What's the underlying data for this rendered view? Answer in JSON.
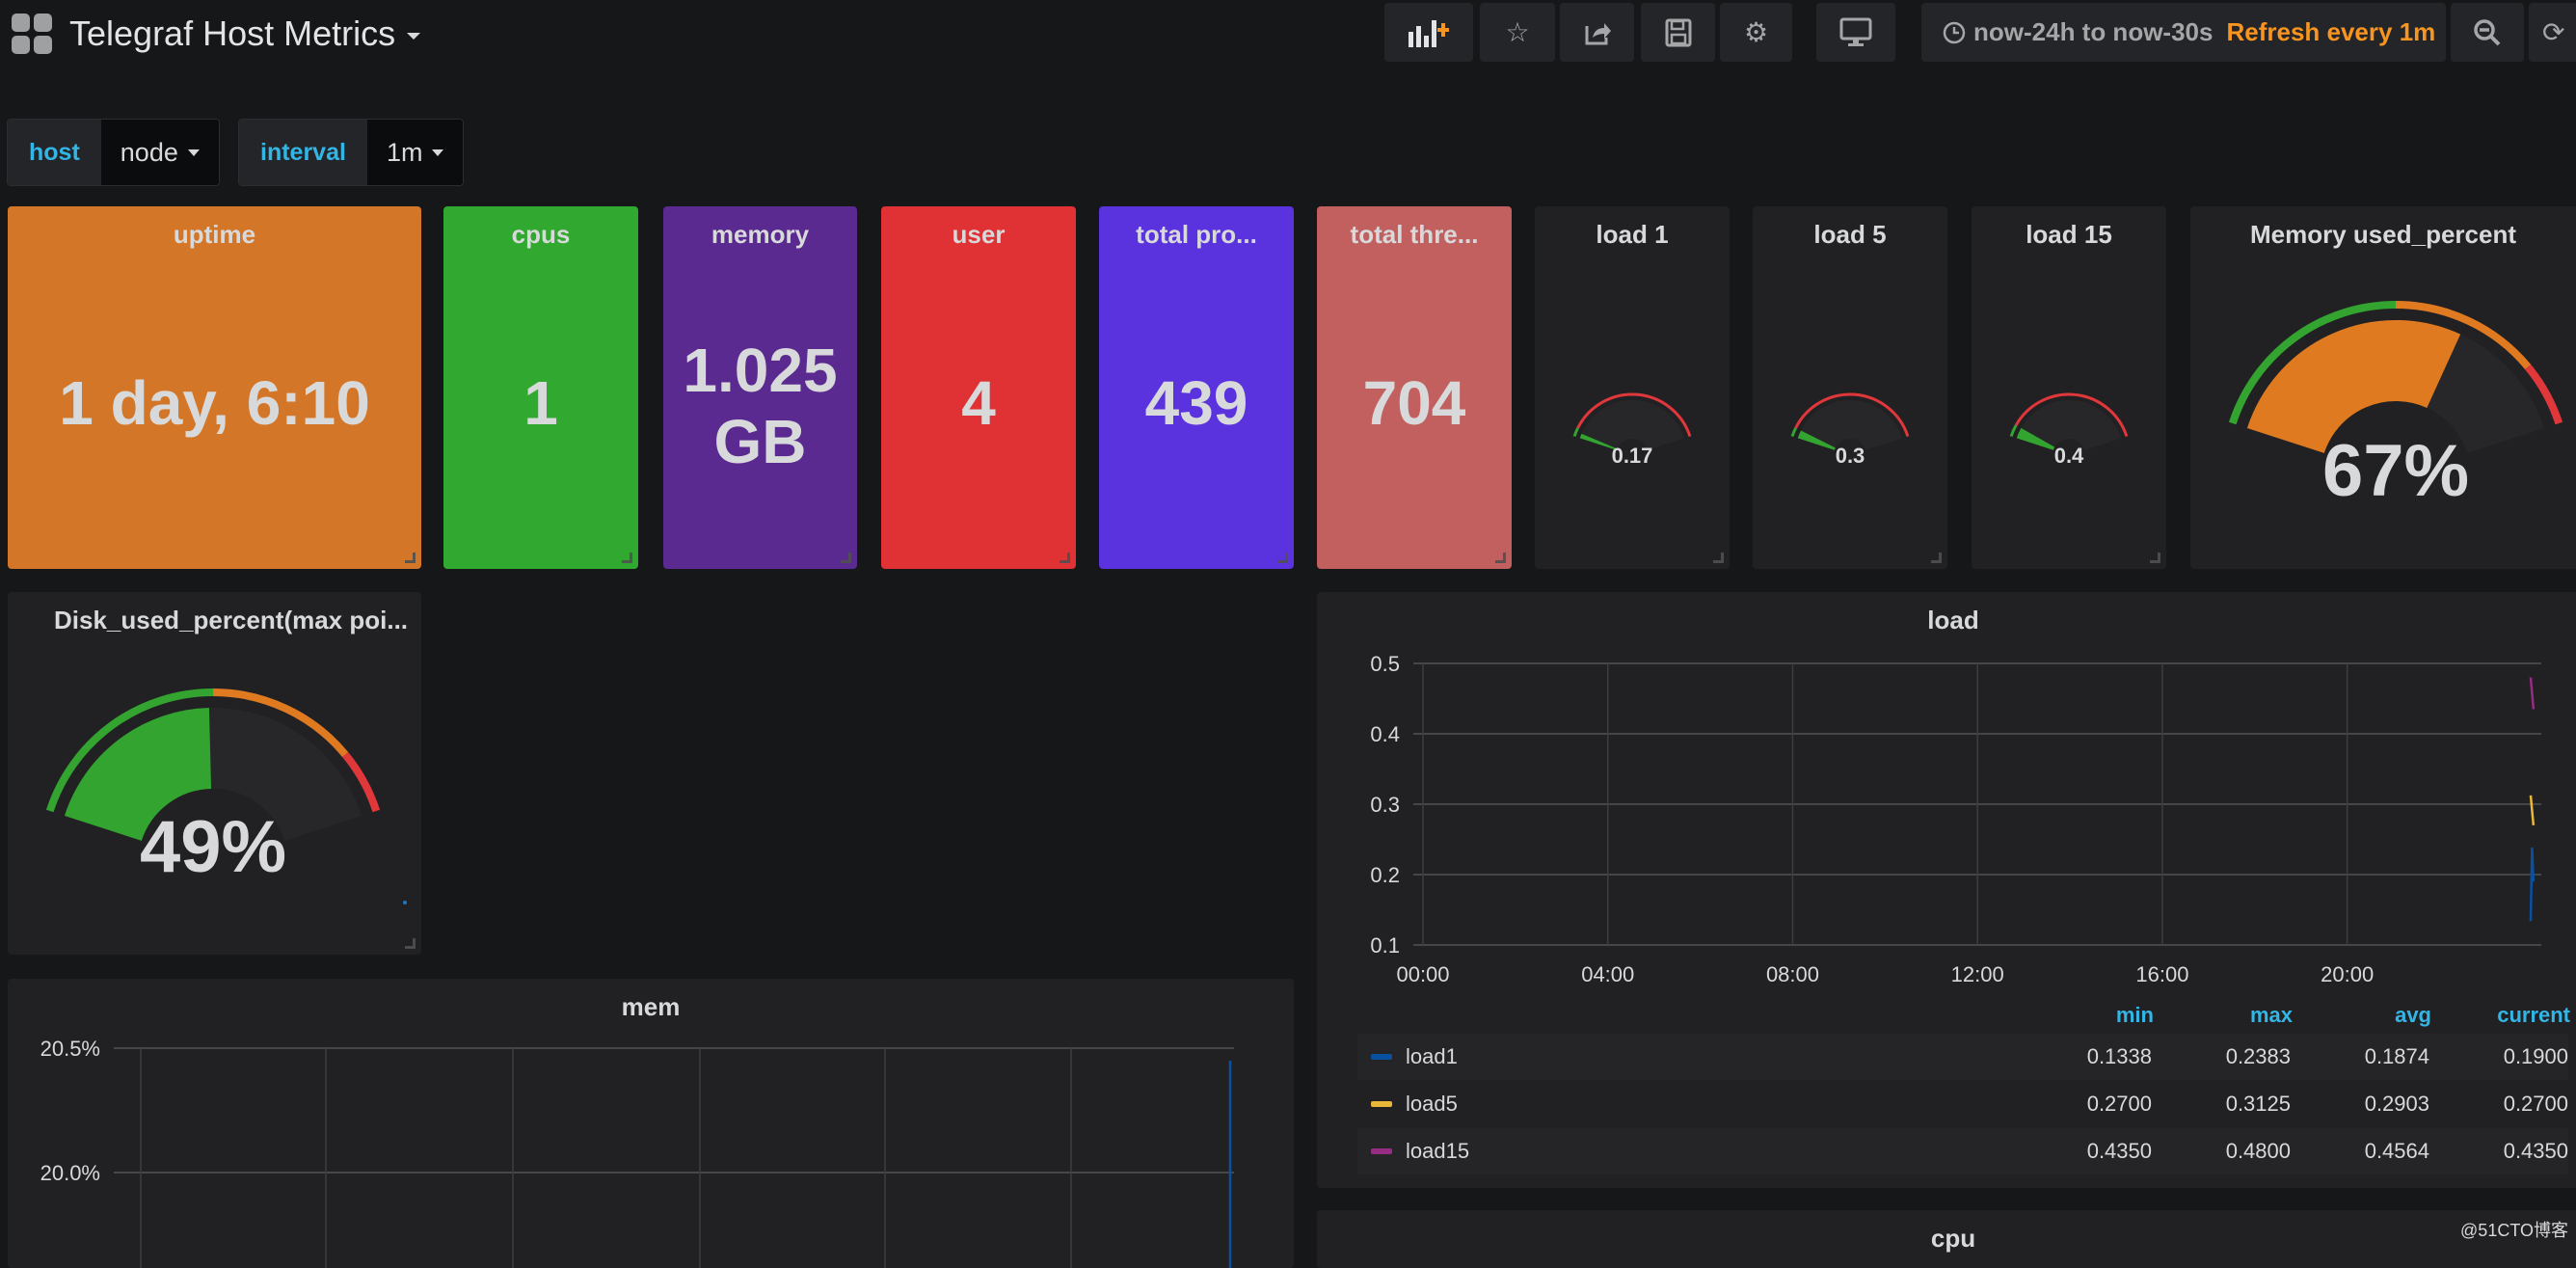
{
  "header": {
    "title": "Telegraf Host Metrics",
    "toolbar": [
      {
        "name": "add-panel-button",
        "icon": "add-panel-icon"
      },
      {
        "name": "star-button",
        "icon": "star-icon"
      },
      {
        "name": "share-button",
        "icon": "share-icon"
      },
      {
        "name": "save-button",
        "icon": "save-icon"
      },
      {
        "name": "settings-button",
        "icon": "gear-icon"
      },
      {
        "name": "tv-mode-button",
        "icon": "monitor-icon"
      },
      {
        "name": "zoom-out-button",
        "icon": "zoom-out-icon"
      },
      {
        "name": "refresh-button",
        "icon": "refresh-icon"
      }
    ],
    "time_range": "now-24h to now-30s",
    "refresh": "Refresh every 1m"
  },
  "variables": [
    {
      "label": "host",
      "value": "node"
    },
    {
      "label": "interval",
      "value": "1m"
    }
  ],
  "stats": [
    {
      "title": "uptime",
      "value": "1 day, 6:10",
      "color": "#d47627"
    },
    {
      "title": "cpus",
      "value": "1",
      "color": "#31a82f"
    },
    {
      "title": "memory",
      "value": "1.025",
      "unit": "GB",
      "color": "#5b2a90"
    },
    {
      "title": "user",
      "value": "4",
      "color": "#e03134"
    },
    {
      "title": "total pro...",
      "value": "439",
      "color": "#5a32de"
    },
    {
      "title": "total thre...",
      "value": "704",
      "color": "#c26060"
    }
  ],
  "colors": {
    "green": "#32a42f",
    "orange": "#e07a21",
    "red": "#e0373b",
    "accent": "#33b5e5",
    "refresh": "#f79520"
  },
  "gauges": [
    {
      "title": "load 1",
      "value": 0.17,
      "display": "0.17",
      "min": 0,
      "max": 5,
      "thresholds": [
        0.3
      ]
    },
    {
      "title": "load 5",
      "value": 0.3,
      "display": "0.3",
      "min": 0,
      "max": 5,
      "thresholds": [
        0.3
      ]
    },
    {
      "title": "load 15",
      "value": 0.4,
      "display": "0.4",
      "min": 0,
      "max": 5,
      "thresholds": [
        0.4
      ]
    },
    {
      "title": "Memory used_percent",
      "value": 67,
      "display": "67%",
      "min": 0,
      "max": 100,
      "thresholds": [
        50,
        85
      ]
    },
    {
      "title": "Disk_used_percent(max poi...",
      "value": 49,
      "display": "49%",
      "min": 0,
      "max": 100,
      "thresholds": [
        50,
        85
      ]
    }
  ],
  "chart_data": [
    {
      "type": "line",
      "title": "load",
      "xlabel": "",
      "ylabel": "",
      "x_ticks": [
        "00:00",
        "04:00",
        "08:00",
        "12:00",
        "16:00",
        "20:00"
      ],
      "y_ticks": [
        "0.5",
        "0.4",
        "0.3",
        "0.2",
        "0.1"
      ],
      "ylim": [
        0.1,
        0.5
      ],
      "grid": true,
      "legend_position": "bottom-table",
      "legend_columns": [
        "min",
        "max",
        "avg",
        "current"
      ],
      "series": [
        {
          "name": "load1",
          "color": "#0a50a1",
          "min": "0.1338",
          "max": "0.2383",
          "avg": "0.1874",
          "current": "0.1900",
          "points": [
            [
              23.97,
              0.1338
            ],
            [
              24.0,
              0.2383
            ],
            [
              24.03,
              0.19
            ]
          ]
        },
        {
          "name": "load5",
          "color": "#eab839",
          "min": "0.2700",
          "max": "0.3125",
          "avg": "0.2903",
          "current": "0.2700",
          "points": [
            [
              23.97,
              0.3125
            ],
            [
              24.03,
              0.27
            ]
          ]
        },
        {
          "name": "load15",
          "color": "#962d82",
          "min": "0.4350",
          "max": "0.4800",
          "avg": "0.4564",
          "current": "0.4350",
          "points": [
            [
              23.97,
              0.48
            ],
            [
              24.03,
              0.435
            ]
          ]
        }
      ]
    },
    {
      "type": "line",
      "title": "mem",
      "y_ticks": [
        "20.5%",
        "20.0%"
      ],
      "ylim": [
        19.5,
        20.5
      ],
      "grid": true,
      "series": [
        {
          "name": "mem",
          "color": "#0a50a1",
          "points": [
            [
              23.99,
              20.45
            ],
            [
              24.0,
              19.5
            ]
          ]
        }
      ]
    },
    {
      "type": "line",
      "title": "cpu",
      "series": []
    }
  ],
  "watermark": "@51CTO博客"
}
